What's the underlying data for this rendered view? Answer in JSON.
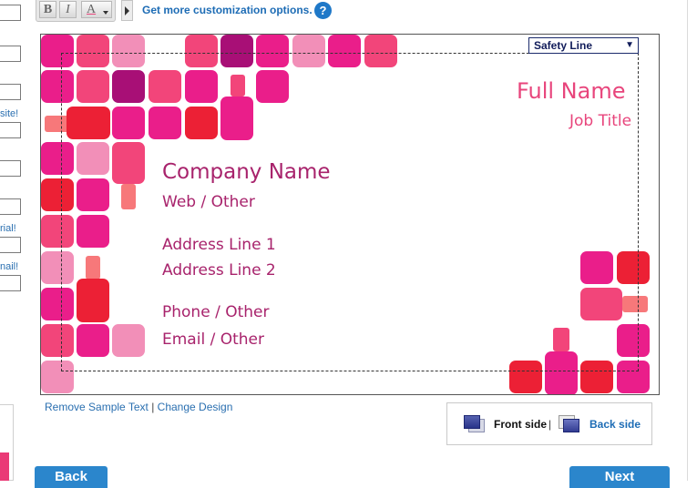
{
  "colors": {
    "pink": "#ea1e8a",
    "pink_mid": "#f2457a",
    "pink_light": "#f28fb8",
    "red": "#ec2035",
    "purple": "#a80f76",
    "salmon": "#f7787a",
    "text_magenta": "#a8236c",
    "text_pink": "#e8457c",
    "link_blue": "#1d6cb5",
    "button_blue": "#2b86cc"
  },
  "left_column": {
    "fragments": [
      "site!",
      "rial!",
      "nail!"
    ]
  },
  "toolbar": {
    "bold": "B",
    "italic": "I",
    "color": "A",
    "customize_link": "Get more customization options.",
    "help": "?"
  },
  "card": {
    "safety_select": "Safety Line",
    "full_name": "Full Name",
    "job_title": "Job Title",
    "company_name": "Company Name",
    "web": "Web / Other",
    "address1": "Address Line 1",
    "address2": "Address Line 2",
    "phone": "Phone / Other",
    "email": "Email / Other"
  },
  "links": {
    "remove": "Remove Sample Text",
    "sep": "|",
    "change": "Change Design"
  },
  "side": {
    "front": "Front side",
    "sep": "|",
    "back": "Back side"
  },
  "nav": {
    "back": "Back",
    "next": "Next"
  }
}
